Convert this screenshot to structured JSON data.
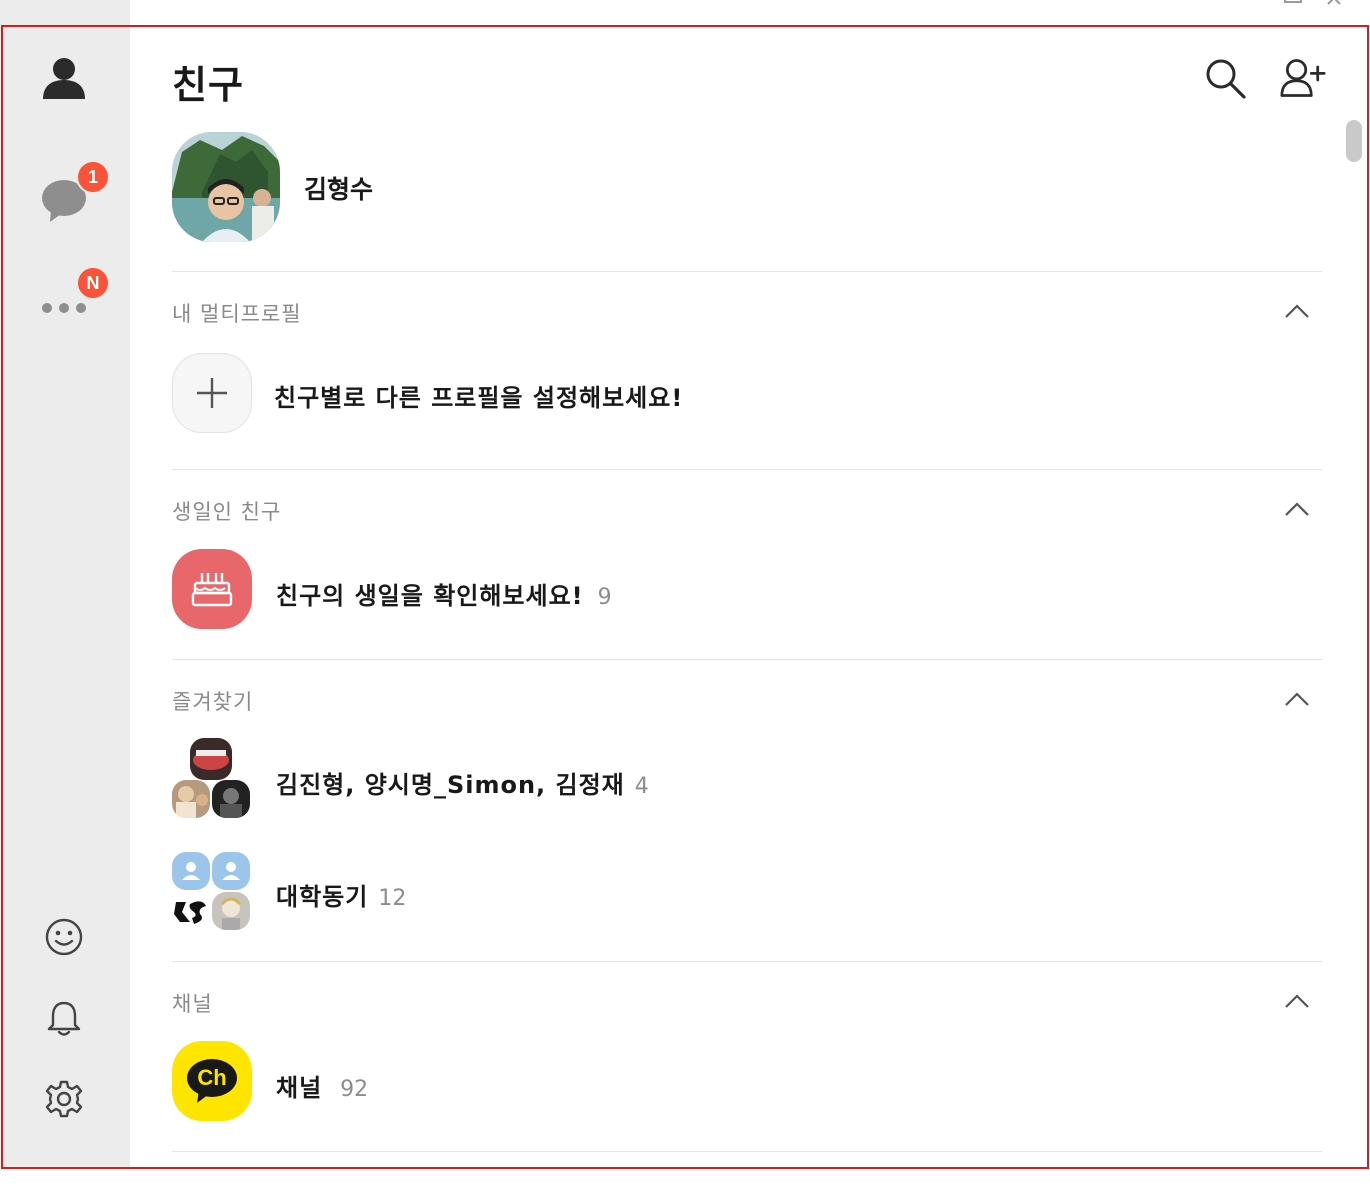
{
  "header": {
    "title": "친구"
  },
  "sidebar": {
    "items": [
      {
        "name": "friends",
        "icon": "person-icon"
      },
      {
        "name": "chats",
        "icon": "chat-bubble-icon",
        "badge": "1"
      },
      {
        "name": "more",
        "icon": "more-dots-icon",
        "badge": "N"
      }
    ],
    "bottom": [
      {
        "name": "emoticon",
        "icon": "smiley-icon"
      },
      {
        "name": "notifications",
        "icon": "bell-icon"
      },
      {
        "name": "settings",
        "icon": "gear-icon"
      }
    ]
  },
  "profile": {
    "name": "김형수"
  },
  "sections": {
    "multiprofile": {
      "title": "내 멀티프로필",
      "item": "친구별로 다른 프로필을 설정해보세요!"
    },
    "birthday": {
      "title": "생일인 친구",
      "item": "친구의 생일을 확인해보세요!",
      "count": "9"
    },
    "favorites": {
      "title": "즐겨찾기",
      "items": [
        {
          "name": "김진형, 양시명_Simon, 김정재",
          "count": "4"
        },
        {
          "name": "대학동기",
          "count": "12"
        }
      ]
    },
    "channel": {
      "title": "채널",
      "item": "채널",
      "count": "92",
      "icon_text": "Ch"
    }
  },
  "colors": {
    "sidebar_bg": "#ececec",
    "badge": "#fa5339",
    "birthday_icon": "#e8676b",
    "channel_icon": "#fee500",
    "frame": "#e01818"
  }
}
